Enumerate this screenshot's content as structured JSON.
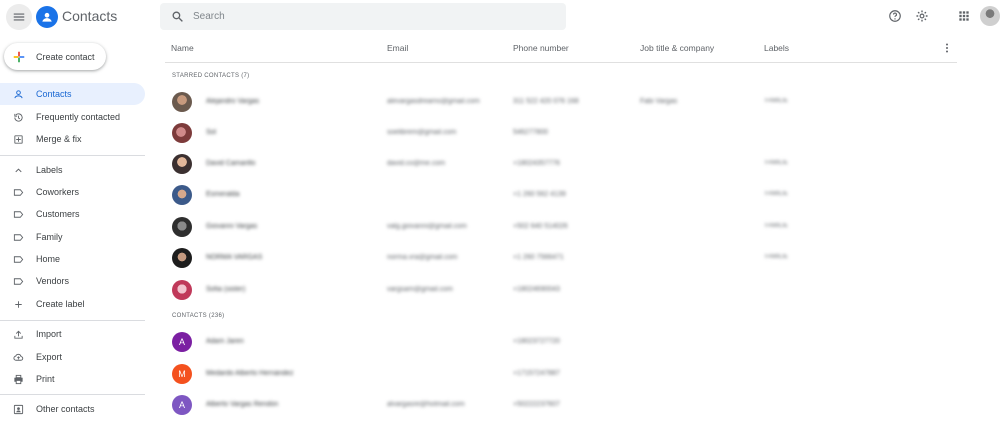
{
  "app": {
    "title": "Contacts"
  },
  "search": {
    "placeholder": "Search"
  },
  "create": {
    "label": "Create contact"
  },
  "sidebar": {
    "items": [
      {
        "label": "Contacts",
        "icon": "person-icon"
      },
      {
        "label": "Frequently contacted",
        "icon": "history-icon"
      },
      {
        "label": "Merge & fix",
        "icon": "merge-icon"
      },
      {
        "label": "Labels",
        "icon": "chevron-up-icon"
      },
      {
        "label": "Coworkers",
        "icon": "label-icon"
      },
      {
        "label": "Customers",
        "icon": "label-icon"
      },
      {
        "label": "Family",
        "icon": "label-icon"
      },
      {
        "label": "Home",
        "icon": "label-icon"
      },
      {
        "label": "Vendors",
        "icon": "label-icon"
      },
      {
        "label": "Create label",
        "icon": "plus-icon"
      },
      {
        "label": "Import",
        "icon": "upload-icon"
      },
      {
        "label": "Export",
        "icon": "cloud-upload-icon"
      },
      {
        "label": "Print",
        "icon": "print-icon"
      },
      {
        "label": "Other contacts",
        "icon": "person-add-icon"
      }
    ]
  },
  "table": {
    "headers": [
      "Name",
      "Email",
      "Phone number",
      "Job title & company",
      "Labels"
    ],
    "starred_label": "STARRED CONTACTS (7)",
    "contacts_label": "CONTACTS (236)",
    "starred": [
      {
        "name": "Alejandro Vargas",
        "email": "alevargasdreams@gmail.com",
        "phone": "311 522 420 076 168",
        "job": "Fabi Vargas",
        "label": "FAMILIE"
      },
      {
        "name": "Sol",
        "email": "soelibrem@gmail.com",
        "phone": "546277800",
        "job": "",
        "label": ""
      },
      {
        "name": "David Camarillo",
        "email": "david.co@me.com",
        "phone": "+18024357776",
        "job": "",
        "label": "FAMILIE"
      },
      {
        "name": "Esmeralda",
        "email": "",
        "phone": "+1 260 562 4139",
        "job": "",
        "label": "FAMILIE"
      },
      {
        "name": "Giovanni Vargas",
        "email": "valg.giovanni@gmail.com",
        "phone": "+502 640 514026",
        "job": "",
        "label": "FAMILIE"
      },
      {
        "name": "NORMA VARGAS",
        "email": "norma.vra@gmail.com",
        "phone": "+1 260 7566471",
        "job": "",
        "label": "FAMILIE"
      },
      {
        "name": "Sofia (sister)",
        "email": "vargsam@gmail.com",
        "phone": "+18024690043",
        "job": "",
        "label": ""
      }
    ],
    "contacts": [
      {
        "name": "Adam Jaren",
        "email": "",
        "phone": "+18023727720",
        "initial": "A",
        "color": "#7b1fa2"
      },
      {
        "name": "Medardo Alberto Hernández",
        "email": "",
        "phone": "+17157247887",
        "initial": "M",
        "color": "#f4511e"
      },
      {
        "name": "Alberto Vargas Rendón",
        "email": "alvargasre@hotmail.com",
        "phone": "+50222237607",
        "initial": "A",
        "color": "#7e57c2"
      }
    ]
  },
  "colors": {
    "accent": "#1a73e8",
    "active_bg": "#e8f0fe"
  }
}
